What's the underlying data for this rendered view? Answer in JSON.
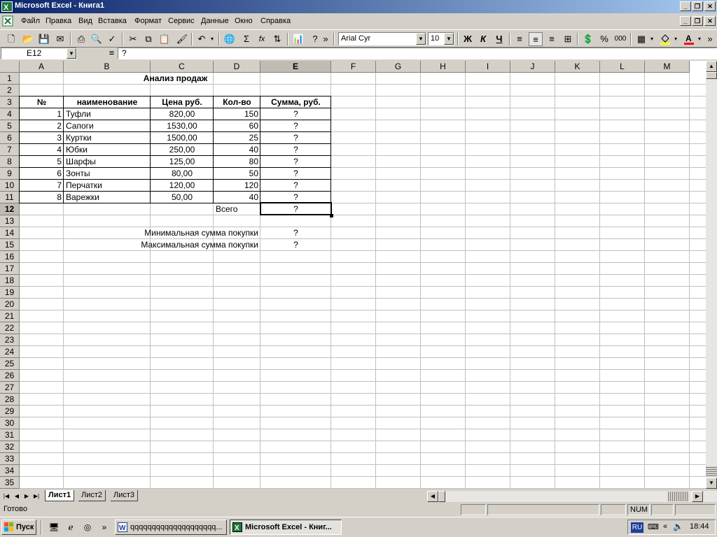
{
  "window": {
    "title": "Microsoft Excel - Книга1",
    "app_icon": "excel-icon"
  },
  "menu": {
    "items": [
      "Файл",
      "Правка",
      "Вид",
      "Вставка",
      "Формат",
      "Сервис",
      "Данные",
      "Окно",
      "Справка"
    ]
  },
  "toolbar": {
    "font_name": "Arial Cyr",
    "font_size": "10",
    "bold": "Ж",
    "italic": "К",
    "underline": "Ч",
    "sum": "Σ",
    "fx": "fx",
    "percent": "%",
    "thousands": "000",
    "more": "»"
  },
  "formula_bar": {
    "cell_ref": "E12",
    "equals": "=",
    "content": "?"
  },
  "columns": [
    "A",
    "B",
    "C",
    "D",
    "E",
    "F",
    "G",
    "H",
    "I",
    "J",
    "K",
    "L",
    "M"
  ],
  "rows": [
    "1",
    "2",
    "3",
    "4",
    "5",
    "6",
    "7",
    "8",
    "9",
    "10",
    "11",
    "12",
    "13",
    "14",
    "15",
    "16",
    "17",
    "18",
    "19",
    "20",
    "21",
    "22",
    "23",
    "24",
    "25",
    "26",
    "27",
    "28",
    "29",
    "30",
    "31",
    "32",
    "33",
    "34",
    "35"
  ],
  "sheet": {
    "title": "Анализ продаж",
    "headers": [
      "№",
      "наименование",
      "Цена руб.",
      "Кол-во",
      "Сумма, руб."
    ],
    "data": [
      [
        "1",
        "Туфли",
        "820,00",
        "150",
        "?"
      ],
      [
        "2",
        "Сапоги",
        "1530,00",
        "60",
        "?"
      ],
      [
        "3",
        "Куртки",
        "1500,00",
        "25",
        "?"
      ],
      [
        "4",
        "Юбки",
        "250,00",
        "40",
        "?"
      ],
      [
        "5",
        "Шарфы",
        "125,00",
        "80",
        "?"
      ],
      [
        "6",
        "Зонты",
        "80,00",
        "50",
        "?"
      ],
      [
        "7",
        "Перчатки",
        "120,00",
        "120",
        "?"
      ],
      [
        "8",
        "Варежки",
        "50,00",
        "40",
        "?"
      ]
    ],
    "total_label": "Всего",
    "total_value": "?",
    "min_label": "Минимальная сумма покупки",
    "min_value": "?",
    "max_label": "Максимальная сумма покупки",
    "max_value": "?"
  },
  "tabs": [
    "Лист1",
    "Лист2",
    "Лист3"
  ],
  "status": {
    "ready": "Готово",
    "num": "NUM"
  },
  "taskbar": {
    "start": "Пуск",
    "buttons": [
      "qqqqqqqqqqqqqqqqqqqq...",
      "Microsoft Excel - Книг..."
    ],
    "lang": "RU",
    "time": "18:44",
    "more": "»"
  }
}
